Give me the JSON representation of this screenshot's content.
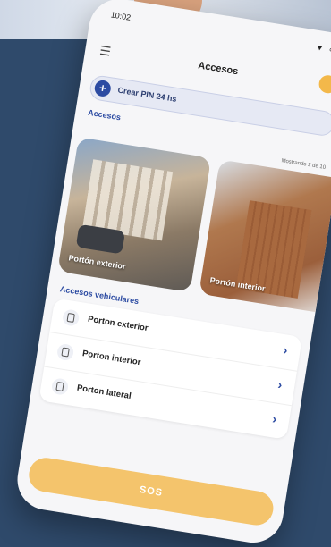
{
  "status_bar": {
    "time": "10:02",
    "icons": "▼ ∞"
  },
  "header": {
    "title": "Accesos",
    "menu_icon": "hamburger-icon",
    "avatar_color": "#f3b84a"
  },
  "pin_button": {
    "label": "Crear PIN 24 hs"
  },
  "accesses": {
    "section_title": "Accesos",
    "showing_text": "Mostrando 2 de 10",
    "cards": [
      {
        "label": "Portón exterior"
      },
      {
        "label": "Portón interior"
      }
    ]
  },
  "vehicular": {
    "section_title": "Accesos vehiculares",
    "items": [
      {
        "label": "Porton exterior"
      },
      {
        "label": "Porton interior"
      },
      {
        "label": "Porton lateral"
      }
    ]
  },
  "sos": {
    "label": "SOS",
    "color": "#f4c46c"
  },
  "colors": {
    "background": "#2f4a6b",
    "accent": "#2c4ba2"
  }
}
